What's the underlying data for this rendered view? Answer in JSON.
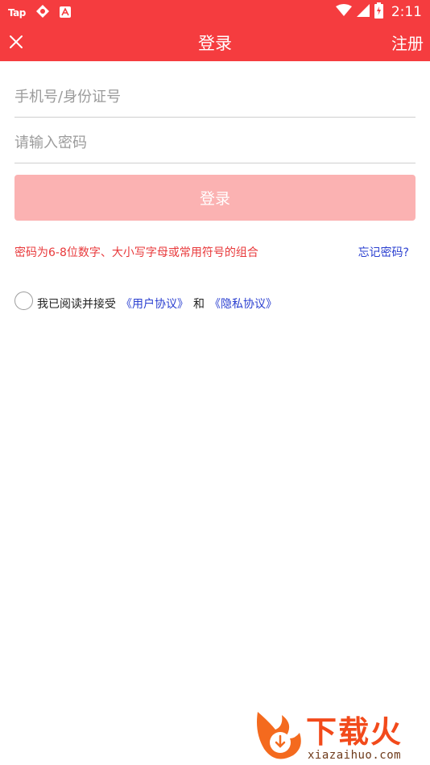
{
  "status_bar": {
    "left_app_label": "Tap",
    "time": "2:11"
  },
  "app_bar": {
    "title": "登录",
    "register_label": "注册",
    "background_color": "#f53c3f"
  },
  "form": {
    "phone_placeholder": "手机号/身份证号",
    "password_placeholder": "请输入密码",
    "login_button_label": "登录",
    "login_button_color": "#fbb2b2"
  },
  "hint": {
    "password_rule": "密码为6-8位数字、大小写字母或常用符号的组合",
    "forgot_password": "忘记密码?"
  },
  "agreement": {
    "prefix": "我已阅读并接受",
    "user_agreement": "《用户协议》",
    "conjunction": "和",
    "privacy_policy": "《隐私协议》",
    "checked": false
  },
  "watermark": {
    "brand": "下载火",
    "url": "xiazaihuo.com"
  }
}
